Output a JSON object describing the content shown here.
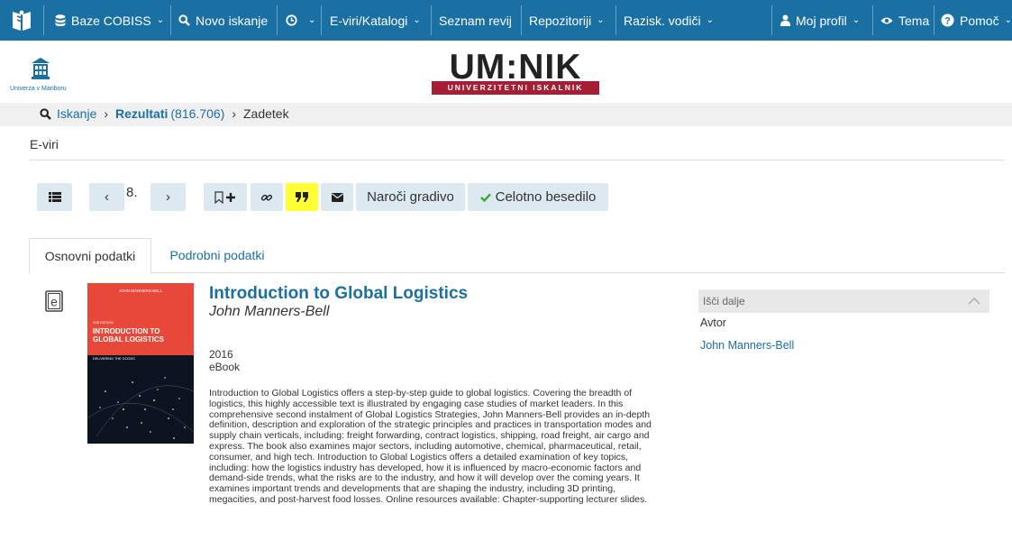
{
  "nav": {
    "items": [
      {
        "label": "Baze COBISS"
      },
      {
        "label": "Novo iskanje"
      },
      {
        "label": ""
      },
      {
        "label": "E-viri/Katalogi"
      },
      {
        "label": "Seznam revij"
      },
      {
        "label": "Repozitoriji"
      },
      {
        "label": "Razisk. vodiči"
      },
      {
        "label": "Moj profil"
      },
      {
        "label": "Tema"
      },
      {
        "label": "Pomoč"
      }
    ]
  },
  "header": {
    "uni_caption": "Univerza v Mariboru",
    "brand_main": "UM:NIK",
    "brand_sub": "UNIVERZITETNI ISKALNIK"
  },
  "breadcrumb": {
    "search": "Iskanje",
    "results": "Rezultati",
    "results_count": "(816.706)",
    "current": "Zadetek"
  },
  "section_title": "E-viri",
  "toolbar": {
    "page_number": "8.",
    "order_label": "Naroči gradivo",
    "fulltext_label": "Celotno besedilo"
  },
  "tabs": [
    {
      "label": "Osnovni podatki"
    },
    {
      "label": "Podrobni podatki"
    }
  ],
  "record": {
    "title": "Introduction to Global Logistics",
    "author": "John Manners-Bell",
    "year": "2016",
    "type": "eBook",
    "description": "Introduction to Global Logistics offers a step-by-step guide to global logistics. Covering the breadth of logistics, this highly accessible text is illustrated by engaging case studies of market leaders. In this comprehensive second instalment of Global Logistics Strategies, John Manners-Bell provides an in-depth definition, description and exploration of the strategic principles and practices in transportation modes and supply chain verticals, including: freight forwarding, contract logistics, shipping, road freight, air cargo and express. The book also examines major sectors, including automotive, chemical, pharmaceutical, retail, consumer, and high tech. Introduction to Global Logistics offers a detailed examination of key topics, including: how the logistics industry has developed, how it is influenced by macro-economic factors and demand-side trends, what the risks are to the industry, and how it will develop over the coming years. It examines important trends and developments that are shaping the industry, including 3D printing, megacities, and post-harvest food losses. Online resources available: Chapter-supporting lecturer slides.",
    "cover": {
      "author": "JOHN MANNERS-BELL",
      "edition": "2ND EDITION",
      "title_line1": "INTRODUCTION TO",
      "title_line2": "GLOBAL LOGISTICS",
      "subtitle": "DELIVERING THE GOODS"
    }
  },
  "side": {
    "heading": "Išči dalje",
    "author_label": "Avtor",
    "author_link": "John Manners-Bell"
  },
  "colors": {
    "nav_bg": "#1a6fa3",
    "link": "#1a6fa3",
    "button_bg": "#dde9f1",
    "highlight": "#ffff33",
    "brand_red": "#a61e34",
    "cover_red": "#e8483a"
  }
}
